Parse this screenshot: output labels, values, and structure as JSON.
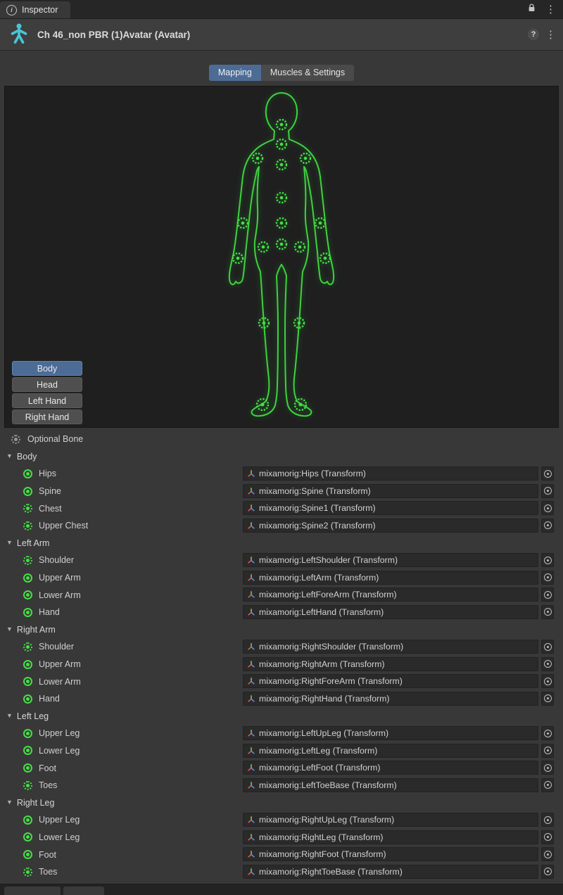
{
  "window": {
    "tab_label": "Inspector"
  },
  "header": {
    "title": "Ch 46_non PBR (1)Avatar (Avatar)"
  },
  "tabs": [
    {
      "label": "Mapping",
      "selected": true
    },
    {
      "label": "Muscles & Settings",
      "selected": false
    }
  ],
  "preview": {
    "buttons": [
      {
        "label": "Body",
        "selected": true
      },
      {
        "label": "Head",
        "selected": false
      },
      {
        "label": "Left Hand",
        "selected": false
      },
      {
        "label": "Right Hand",
        "selected": false
      }
    ]
  },
  "legend": {
    "optional_bone": "Optional Bone"
  },
  "icons": {
    "help": "?",
    "kebab": "⋮",
    "info": "i",
    "foldout": "▼"
  },
  "colors": {
    "accent_blue": "#4C6C96",
    "bone_green": "#45E045",
    "avatar_cyan": "#49C5D6"
  },
  "bone_groups": [
    {
      "label": "Body",
      "bones": [
        {
          "label": "Hips",
          "optional": false,
          "value": "mixamorig:Hips (Transform)"
        },
        {
          "label": "Spine",
          "optional": false,
          "value": "mixamorig:Spine (Transform)"
        },
        {
          "label": "Chest",
          "optional": true,
          "value": "mixamorig:Spine1 (Transform)"
        },
        {
          "label": "Upper Chest",
          "optional": true,
          "value": "mixamorig:Spine2 (Transform)"
        }
      ]
    },
    {
      "label": "Left Arm",
      "bones": [
        {
          "label": "Shoulder",
          "optional": true,
          "value": "mixamorig:LeftShoulder (Transform)"
        },
        {
          "label": "Upper Arm",
          "optional": false,
          "value": "mixamorig:LeftArm (Transform)"
        },
        {
          "label": "Lower Arm",
          "optional": false,
          "value": "mixamorig:LeftForeArm (Transform)"
        },
        {
          "label": "Hand",
          "optional": false,
          "value": "mixamorig:LeftHand (Transform)"
        }
      ]
    },
    {
      "label": "Right Arm",
      "bones": [
        {
          "label": "Shoulder",
          "optional": true,
          "value": "mixamorig:RightShoulder (Transform)"
        },
        {
          "label": "Upper Arm",
          "optional": false,
          "value": "mixamorig:RightArm (Transform)"
        },
        {
          "label": "Lower Arm",
          "optional": false,
          "value": "mixamorig:RightForeArm (Transform)"
        },
        {
          "label": "Hand",
          "optional": false,
          "value": "mixamorig:RightHand (Transform)"
        }
      ]
    },
    {
      "label": "Left Leg",
      "bones": [
        {
          "label": "Upper Leg",
          "optional": false,
          "value": "mixamorig:LeftUpLeg (Transform)"
        },
        {
          "label": "Lower Leg",
          "optional": false,
          "value": "mixamorig:LeftLeg (Transform)"
        },
        {
          "label": "Foot",
          "optional": false,
          "value": "mixamorig:LeftFoot (Transform)"
        },
        {
          "label": "Toes",
          "optional": true,
          "value": "mixamorig:LeftToeBase (Transform)"
        }
      ]
    },
    {
      "label": "Right Leg",
      "bones": [
        {
          "label": "Upper Leg",
          "optional": false,
          "value": "mixamorig:RightUpLeg (Transform)"
        },
        {
          "label": "Lower Leg",
          "optional": false,
          "value": "mixamorig:RightLeg (Transform)"
        },
        {
          "label": "Foot",
          "optional": false,
          "value": "mixamorig:RightFoot (Transform)"
        },
        {
          "label": "Toes",
          "optional": true,
          "value": "mixamorig:RightToeBase (Transform)"
        }
      ]
    }
  ]
}
